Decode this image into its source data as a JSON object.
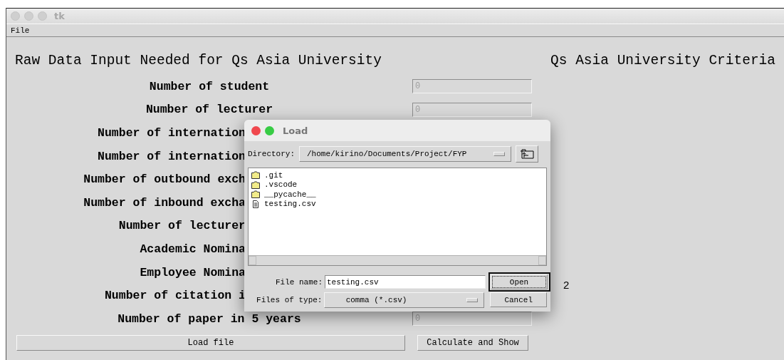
{
  "window": {
    "title": "tk"
  },
  "menu": [
    "File"
  ],
  "heading_left": "Raw Data Input Needed for Qs Asia University",
  "heading_right": "Qs Asia University Criteria",
  "rows": [
    {
      "label": "Number of student",
      "value": "0"
    },
    {
      "label": "Number of lecturer",
      "value": "0"
    },
    {
      "label": "Number of internation"
    },
    {
      "label": "Number of internation"
    },
    {
      "label": "Number of outbound exch"
    },
    {
      "label": "Number of inbound excha"
    },
    {
      "label": "Number of lecturer"
    },
    {
      "label": "Academic Nomina"
    },
    {
      "label": "Employee Nomina"
    },
    {
      "label": "Number of citation i"
    },
    {
      "label": "Number of paper in 5 years",
      "value": "0"
    }
  ],
  "load_button": "Load file",
  "calc_button": "Calculate and Show",
  "dialog": {
    "title": "Load",
    "directory_label": "Directory:",
    "directory": "/home/kirino/Documents/Project/FYP",
    "files": [
      {
        "name": ".git",
        "kind": "folder"
      },
      {
        "name": ".vscode",
        "kind": "folder"
      },
      {
        "name": "__pycache__",
        "kind": "folder"
      },
      {
        "name": "testing.csv",
        "kind": "file"
      }
    ],
    "file_name_label": "File name:",
    "file_name": "testing.csv",
    "file_type_label": "Files of type:",
    "file_type": "comma (*.csv)",
    "buttons": [
      {
        "label": "Open",
        "focused": true
      },
      {
        "label": "Cancel",
        "focused": false
      }
    ],
    "annotation": "2"
  }
}
